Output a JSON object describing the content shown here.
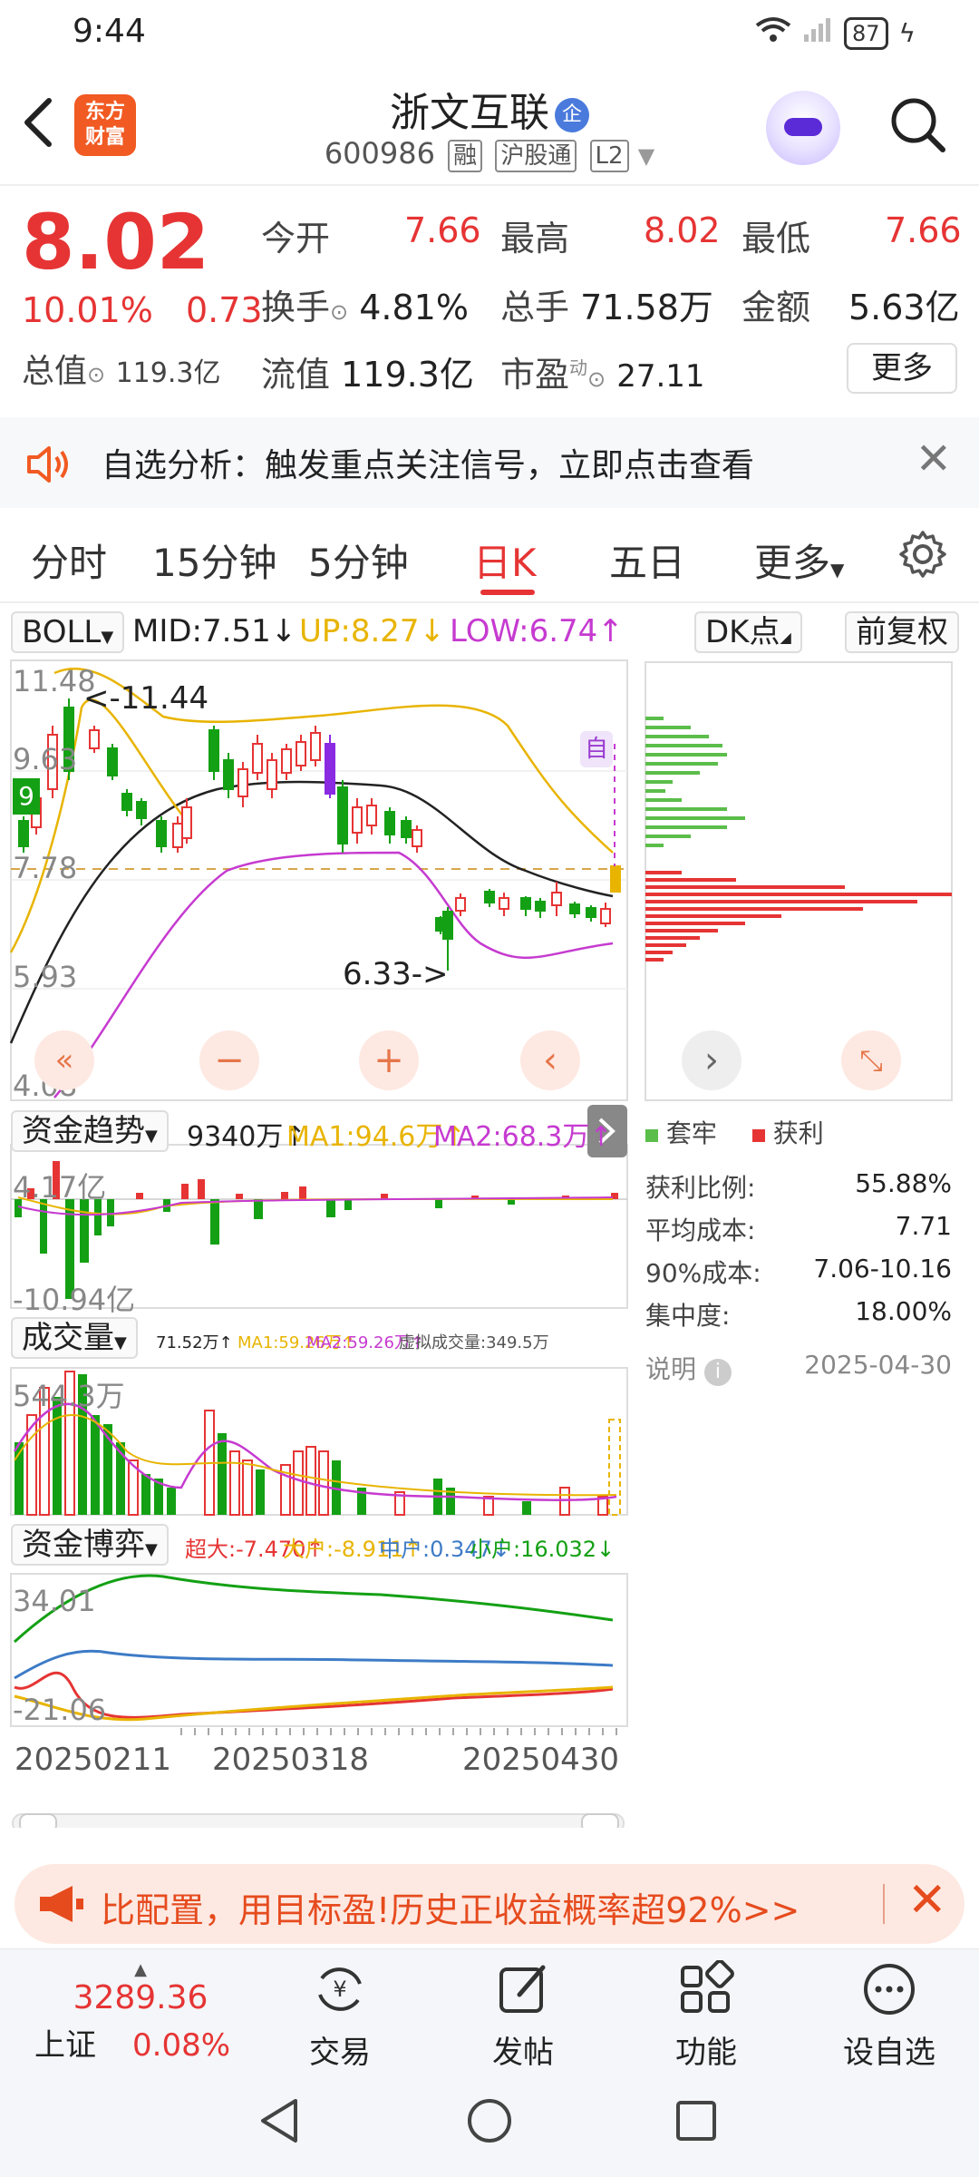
{
  "status_bar": {
    "time": "9:44",
    "battery": "87"
  },
  "header": {
    "logo_line1": "东方",
    "logo_line2": "财富",
    "stock_name": "浙文互联",
    "name_badge": "企",
    "stock_code": "600986",
    "tags": [
      "融",
      "沪股通",
      "L2"
    ]
  },
  "quote": {
    "price": "8.02",
    "change_pct": "10.01%",
    "change_amt": "0.73",
    "total_value_label": "总值",
    "total_value": "119.3亿",
    "rows": [
      [
        {
          "label": "今开",
          "value": "7.66"
        },
        {
          "label": "最高",
          "value": "8.02"
        },
        {
          "label": "最低",
          "value": "7.66"
        }
      ],
      [
        {
          "label": "换手",
          "value": "4.81%"
        },
        {
          "label": "总手",
          "value": "71.58万"
        },
        {
          "label": "金额",
          "value": "5.63亿"
        }
      ],
      [
        {
          "label": "流值",
          "value": "119.3亿"
        },
        {
          "label": "市盈",
          "sup": "动",
          "value": "27.11"
        }
      ]
    ],
    "more_label": "更多"
  },
  "notice": {
    "text": "自选分析：触发重点关注信号，立即点击查看"
  },
  "tabs": [
    "分时",
    "15分钟",
    "5分钟",
    "日K",
    "五日",
    "更多"
  ],
  "active_tab": "日K",
  "kline": {
    "indicator": "BOLL",
    "mid": "MID:7.51↓",
    "up": "UP:8.27↓",
    "low": "LOW:6.74↑",
    "dk_label": "DK点",
    "adj_label": "前复权",
    "y_labels": [
      "11.48",
      "9.63",
      "7.78",
      "5.93",
      "4.08"
    ],
    "high_marker": "<-11.44",
    "low_marker": "6.33->",
    "auto_label": "自",
    "current_tag": "9"
  },
  "fund_trend": {
    "title": "资金趋势",
    "value": "9340万↑",
    "ma1": "MA1:94.6万↑",
    "ma2": "MA2:68.3万↑",
    "y_top": "4.17亿",
    "y_bottom": "-10.94亿"
  },
  "volume": {
    "title": "成交量",
    "value": "71.52万↑",
    "ma1": "MA1:59.26万↑",
    "ma2": "MA2:59.26万↑",
    "virtual": "虚拟成交量:349.5万",
    "y_top": "544.3万"
  },
  "fund_game": {
    "title": "资金博弈",
    "super": "超大:-7.470↑",
    "large": "大户:-8.911↑",
    "mid": "中户:0.347↓",
    "small": "小户:16.032↓",
    "y_top": "34.01",
    "y_bottom": "-21.06"
  },
  "x_dates": [
    "20250211",
    "20250318",
    "20250430"
  ],
  "chip": {
    "legend_trapped": "套牢",
    "legend_profit": "获利",
    "stats": [
      {
        "label": "获利比例:",
        "value": "55.88%"
      },
      {
        "label": "平均成本:",
        "value": "7.71"
      },
      {
        "label": "90%成本:",
        "value": "7.06-10.16"
      },
      {
        "label": "集中度:",
        "value": "18.00%"
      }
    ],
    "note_label": "说明",
    "date": "2025-04-30"
  },
  "promo": {
    "text": "比配置，用目标盈!历史正收益概率超92%>>"
  },
  "bottom_bar": {
    "index_value": "3289.36",
    "index_name": "上证",
    "index_change": "0.08%",
    "items": [
      "交易",
      "发帖",
      "功能",
      "设自选"
    ]
  },
  "colors": {
    "red": "#e63434",
    "green": "#14a014",
    "accent_orange": "#f15a22",
    "boll_mid": "#222222",
    "boll_up": "#e8b400",
    "boll_low": "#c63ad0"
  }
}
